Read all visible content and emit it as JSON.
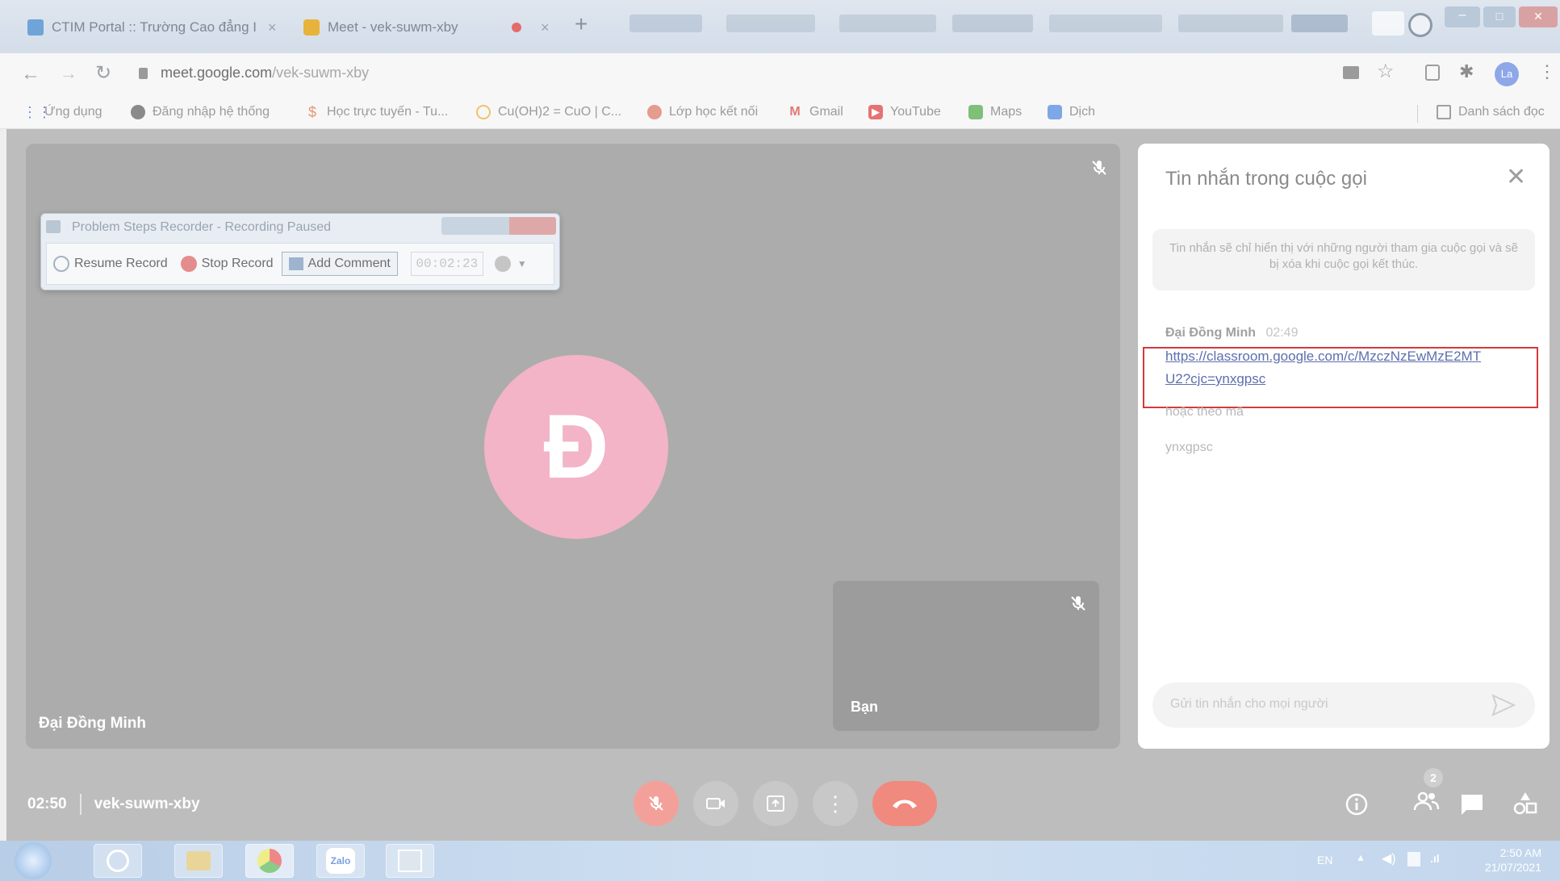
{
  "browser": {
    "tabs": [
      {
        "title": "CTIM Portal :: Trường Cao đẳng I",
        "close": "×"
      },
      {
        "title": "Meet - vek-suwm-xby"
      },
      {
        "close": "×"
      }
    ],
    "new_tab": "+",
    "url_host": "meet.google.com",
    "url_path": "/vek-suwm-xby",
    "profile_initials": "La",
    "window_controls": {
      "minimize": "–",
      "maximize": "□",
      "close": "✕"
    }
  },
  "bookmarks": {
    "items": [
      "Ứng dụng",
      "Đăng nhập hệ thống",
      "Học trực tuyến - Tu...",
      "Cu(OH)2 = CuO | C...",
      "Lớp học kết nối",
      "Gmail",
      "YouTube",
      "Maps",
      "Dịch"
    ],
    "reading_list": "Danh sách đọc"
  },
  "meet": {
    "speaker_name": "Đại Đồng Minh",
    "avatar_letter": "Đ",
    "self_label": "Bạn",
    "time": "02:50",
    "meeting_code": "vek-suwm-xby",
    "participants_count": "2",
    "colors": {
      "avatar": "#f2b4c6",
      "hangup": "#f08a7e",
      "mic_off": "#f4a09a"
    }
  },
  "chat": {
    "title": "Tin nhắn trong cuộc gọi",
    "info": "Tin nhắn sẽ chỉ hiển thị với những người tham gia cuộc gọi và sẽ bị xóa khi cuộc gọi kết thúc.",
    "message": {
      "sender": "Đại Đồng Minh",
      "time": "02:49",
      "link_line1": "https://classroom.google.com/c/MzczNzEwMzE2MT",
      "link_line2": "U2?cjc=ynxgpsc",
      "line2": "hoặc theo mã",
      "line3": "ynxgpsc"
    },
    "input_placeholder": "Gửi tin nhắn cho mọi người"
  },
  "psr": {
    "title": "Problem Steps Recorder - Recording Paused",
    "resume": "Resume Record",
    "stop": "Stop Record",
    "comment": "Add Comment",
    "timer": "00:02:23"
  },
  "taskbar": {
    "lang": "EN",
    "time": "2:50 AM",
    "date": "21/07/2021",
    "zalo": "Zalo"
  }
}
